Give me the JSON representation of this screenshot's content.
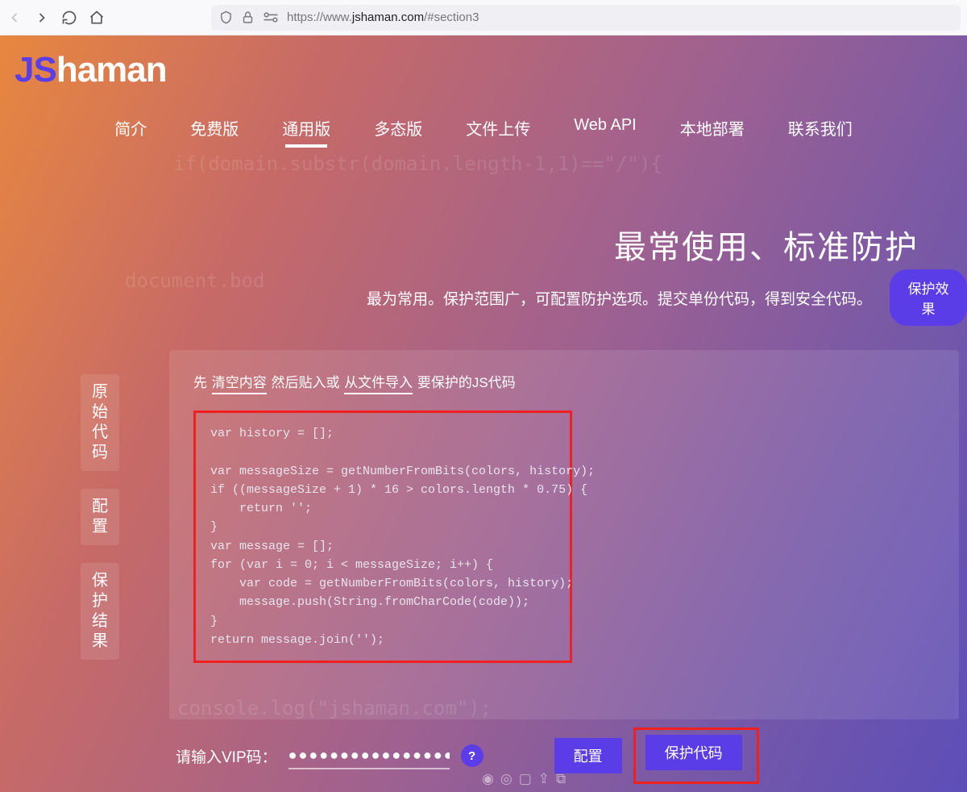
{
  "browser": {
    "url_prefix": "https://www.",
    "url_host": "jshaman.com",
    "url_suffix": "/#section3"
  },
  "logo": {
    "accent": "JS",
    "rest": "haman"
  },
  "nav": {
    "items": [
      "简介",
      "免费版",
      "通用版",
      "多态版",
      "文件上传",
      "Web API",
      "本地部署",
      "联系我们"
    ],
    "active_index": 2
  },
  "hero": {
    "title": "最常使用、标准防护",
    "subtitle": "最为常用。保护范围广，可配置防护选项。提交单份代码，得到安全代码。",
    "button": "保护效果"
  },
  "side_tabs": [
    "原始代码",
    "配置",
    "保护结果"
  ],
  "panel": {
    "instr_pre": "先 ",
    "instr_clear": "清空内容",
    "instr_mid": " 然后贴入或 ",
    "instr_import": "从文件导入",
    "instr_post": " 要保护的JS代码",
    "code": "var history = [];\n\nvar messageSize = getNumberFromBits(colors, history);\nif ((messageSize + 1) * 16 > colors.length * 0.75) {\n    return '';\n}\nvar message = [];\nfor (var i = 0; i < messageSize; i++) {\n    var code = getNumberFromBits(colors, history);\n    message.push(String.fromCharCode(code));\n}\nreturn message.join('');"
  },
  "actions": {
    "vip_label": "请输入VIP码：",
    "vip_value": "●●●●●●●●●●●●●●●●●●●●●",
    "help": "?",
    "config": "配置",
    "protect": "保护代码"
  },
  "bg_text": {
    "a": "if(domain.substr(domain.length-1,1)==\"/\"){",
    "b": "document.bod",
    "c": "console.log(\"jshaman.com\");"
  }
}
